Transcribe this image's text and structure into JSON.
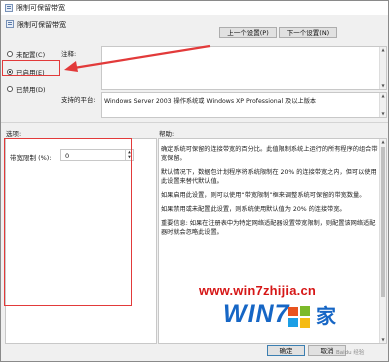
{
  "window": {
    "title": "限制可保留带宽"
  },
  "header": {
    "title": "限制可保留带宽",
    "prev_button": "上一个设置(P)",
    "next_button": "下一个设置(N)"
  },
  "radios": [
    {
      "label": "未配置(C)",
      "selected": false
    },
    {
      "label": "已启用(E)",
      "selected": true
    },
    {
      "label": "已禁用(D)",
      "selected": false
    }
  ],
  "comment_label": "注释:",
  "supported_label": "支持的平台:",
  "supported_text": "Windows Server 2003 操作系统或 Windows XP Professional 及以上版本",
  "options_label": "选项:",
  "help_label": "帮助:",
  "bandwidth": {
    "label": "带宽限制 (%):",
    "value": "0"
  },
  "help_paragraphs": [
    "确定系统可保留的连接带宽的百分比。此值限制系统上运行的所有程序的组合带宽保留。",
    "默认情况下，数据包计划程序将系统限制在 20% 的连接带宽之内，但可以使用此设置来替代默认值。",
    "如果启用此设置，则可以使用“带宽限制”框来调整系统可保留的带宽数量。",
    "如果禁用或未配置此设置，则系统使用默认值为 20% 的连接带宽。",
    "重要信息: 如果在注册表中为特定网络适配器设置带宽限制，则配置该网络适配器时就会忽略此设置。"
  ],
  "footer": {
    "ok": "确定",
    "cancel": "取消"
  },
  "watermark": {
    "url": "www.win7zhijia.cn",
    "logo": "WIN7",
    "logo_cn": "家",
    "corner": "Baidu 经验"
  },
  "colors": {
    "highlight": "#e23a3a",
    "watermark_red": "#d61717",
    "watermark_blue": "#1666c5"
  }
}
